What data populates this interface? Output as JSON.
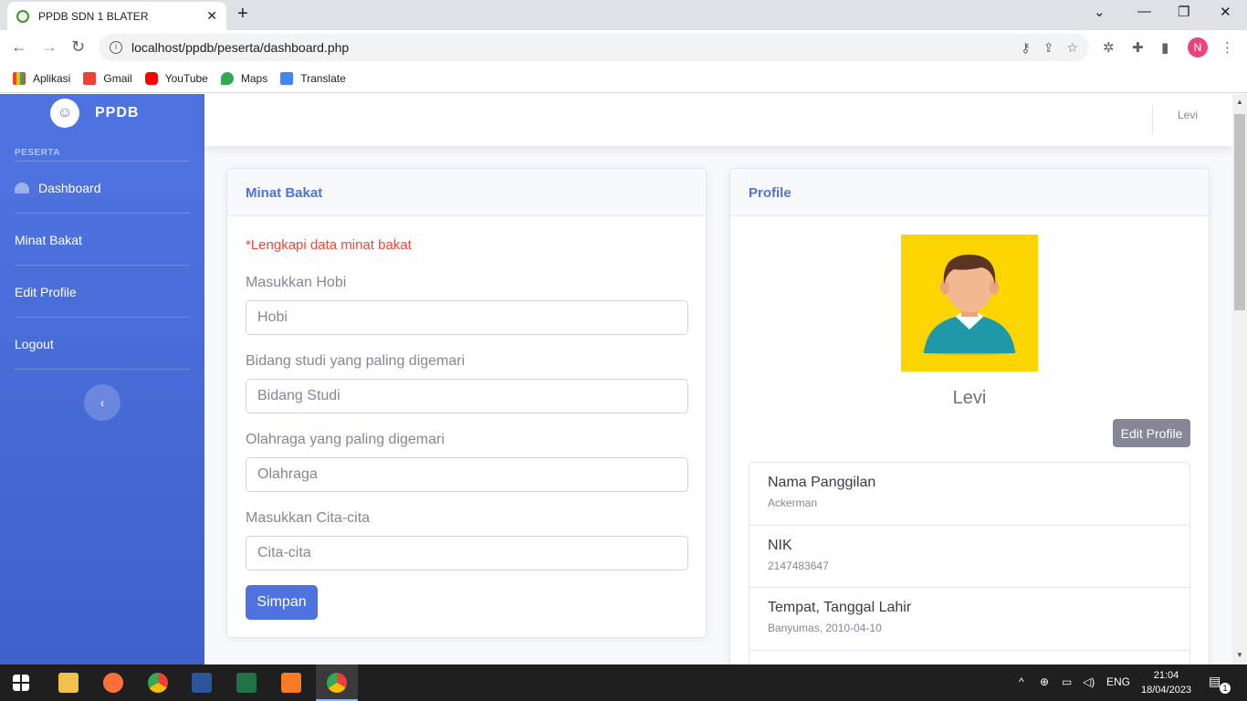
{
  "browser": {
    "tab_title": "PPDB SDN 1 BLATER",
    "tab_close": "✕",
    "new_tab": "+",
    "url": "localhost/ppdb/peserta/dashboard.php",
    "profile_initial": "N",
    "bookmarks": [
      "Aplikasi",
      "Gmail",
      "YouTube",
      "Maps",
      "Translate"
    ]
  },
  "sidebar": {
    "brand": "PPDB",
    "heading": "PESERTA",
    "items": [
      {
        "label": "Dashboard"
      },
      {
        "label": "Minat Bakat"
      },
      {
        "label": "Edit Profile"
      },
      {
        "label": "Logout"
      }
    ],
    "toggle": "‹"
  },
  "topbar": {
    "user": "Levi"
  },
  "minat": {
    "title": "Minat Bakat",
    "warning": "*Lengkapi data minat bakat",
    "fields": [
      {
        "label": "Masukkan Hobi",
        "placeholder": "Hobi"
      },
      {
        "label": "Bidang studi yang paling digemari",
        "placeholder": "Bidang Studi"
      },
      {
        "label": "Olahraga yang paling digemari",
        "placeholder": "Olahraga"
      },
      {
        "label": "Masukkan Cita-cita",
        "placeholder": "Cita-cita"
      }
    ],
    "submit": "Simpan"
  },
  "profile": {
    "title": "Profile",
    "name": "Levi",
    "edit_button": "Edit Profile",
    "details": [
      {
        "key": "Nama Panggilan",
        "value": "Ackerman"
      },
      {
        "key": "NIK",
        "value": "2147483647"
      },
      {
        "key": "Tempat, Tanggal Lahir",
        "value": "Banyumas, 2010-04-10"
      }
    ]
  },
  "taskbar": {
    "lang": "ENG",
    "time": "21:04",
    "date": "18/04/2023",
    "notifications": "1"
  },
  "colors": {
    "primary": "#4e73df",
    "danger": "#e74a3b",
    "secondary": "#858796"
  }
}
